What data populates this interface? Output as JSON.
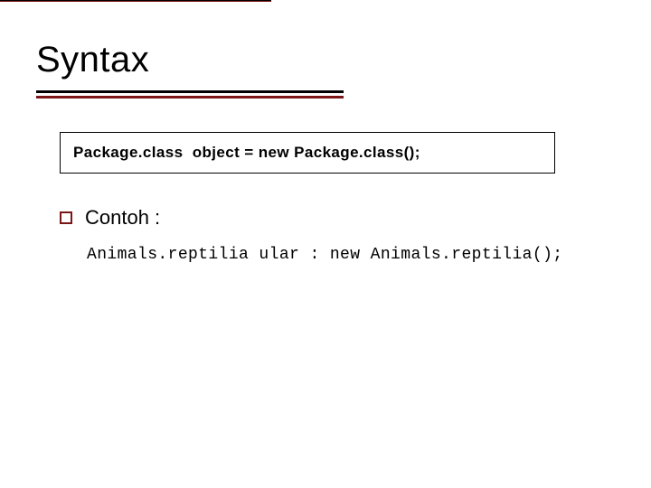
{
  "title": "Syntax",
  "syntax_box": "Package.class  object = new Package.class();",
  "bullet": {
    "label": "Contoh :"
  },
  "example_code": "Animals.reptilia ular : new Animals.reptilia();",
  "colors": {
    "accent": "#7c1616"
  }
}
